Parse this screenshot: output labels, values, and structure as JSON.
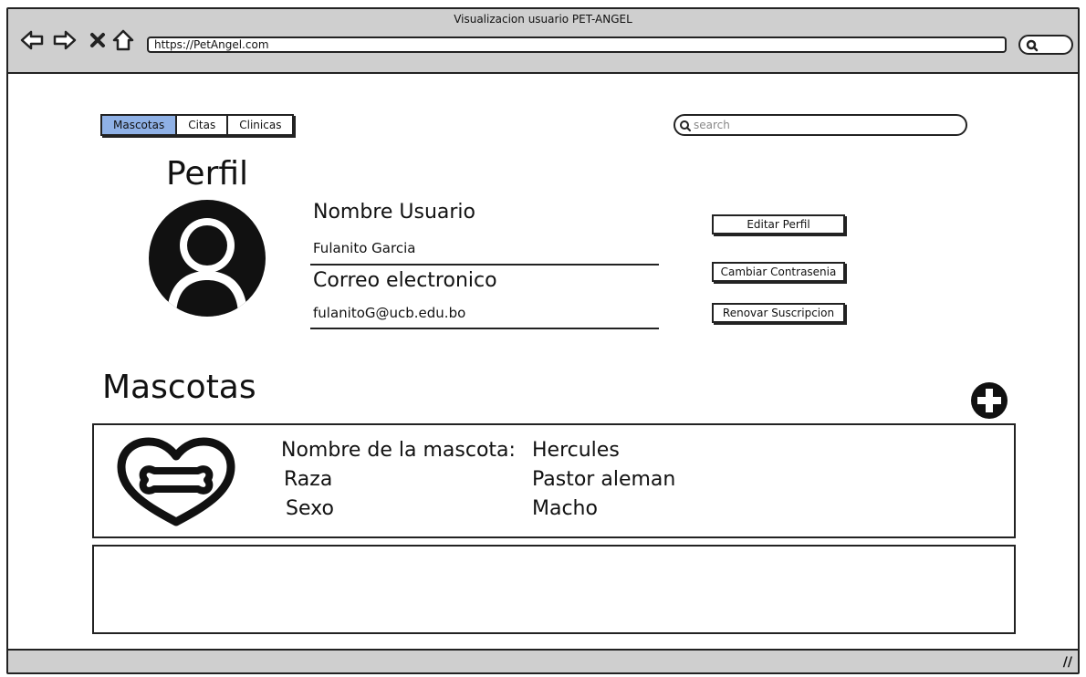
{
  "window": {
    "title": "Visualizacion usuario PET-ANGEL"
  },
  "browser": {
    "url": "https://PetAngel.com"
  },
  "nav_tabs": [
    "Mascotas",
    "Citas",
    "Clinicas"
  ],
  "search": {
    "placeholder": "search"
  },
  "profile": {
    "heading": "Perfil",
    "name_label": "Nombre Usuario",
    "name_value": "Fulanito Garcia",
    "email_label": "Correo electronico",
    "email_value": "fulanitoG@ucb.edu.bo"
  },
  "actions": {
    "edit": "Editar Perfil",
    "change_password": "Cambiar Contrasenia",
    "renew": "Renovar Suscripcion"
  },
  "pets_section": {
    "heading": "Mascotas"
  },
  "pet": {
    "name_label": "Nombre de la mascota:",
    "name_value": "Hercules",
    "breed_label": "Raza",
    "breed_value": "Pastor aleman",
    "sex_label": "Sexo",
    "sex_value": "Macho"
  },
  "icons": [
    "back-icon",
    "forward-icon",
    "close-icon",
    "home-icon",
    "search-icon",
    "avatar-icon",
    "add-icon",
    "pet-heart-bone-icon",
    "resize-grip-icon"
  ],
  "colors": {
    "active_tab": "#8fb1e6",
    "chrome": "#cfcfcf"
  }
}
